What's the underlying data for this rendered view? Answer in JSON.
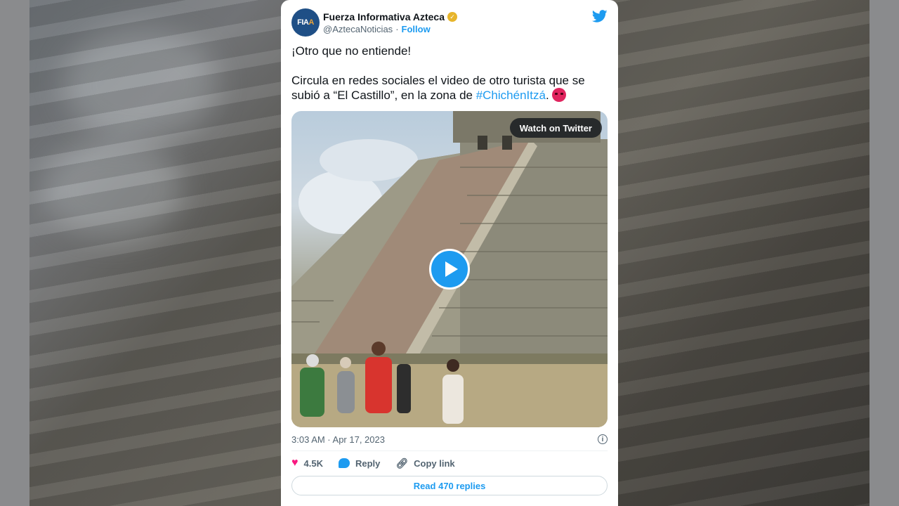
{
  "account": {
    "name": "Fuerza Informativa Azteca",
    "handle": "@AztecaNoticias",
    "separator": "·",
    "follow_label": "Follow",
    "avatar_text": "FIA",
    "avatar_accent": "A",
    "verified": true
  },
  "tweet": {
    "line1": "¡Otro que no entiende!",
    "line2_prefix": "Circula en redes sociales el video de otro turista que se subió a “El Castillo”, en la zona de ",
    "hashtag": "#ChichénItzá",
    "line2_suffix": ". ",
    "emoji": "angry-face"
  },
  "media": {
    "watch_label": "Watch on Twitter",
    "type": "video"
  },
  "meta": {
    "timestamp": "3:03 AM · Apr 17, 2023"
  },
  "actions": {
    "likes": "4.5K",
    "reply_label": "Reply",
    "copy_link_label": "Copy link",
    "read_replies_label": "Read 470 replies"
  },
  "colors": {
    "accent": "#1d9bf0",
    "like": "#f91880",
    "verified": "#e7b52c"
  },
  "icons": {
    "brand": "twitter-bird-icon",
    "info": "info-icon",
    "like": "heart-icon",
    "reply": "reply-bubble-icon",
    "copy": "link-icon",
    "play": "play-icon"
  }
}
